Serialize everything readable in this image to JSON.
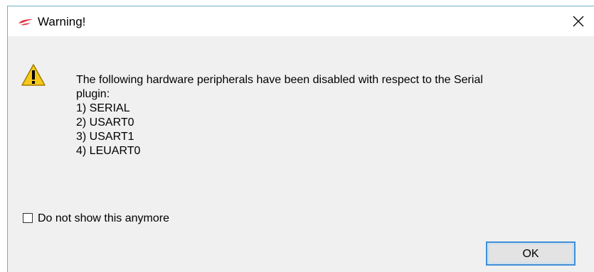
{
  "window": {
    "title": "Warning!",
    "app_icon": "silabs-logo-icon",
    "close_icon": "close-icon",
    "accent_color": "#3c8fd9"
  },
  "message": {
    "icon": "warning-icon",
    "line1": "The following hardware peripherals have been disabled with respect to the Serial",
    "line2": "plugin:",
    "items": [
      "1) SERIAL",
      "2) USART0",
      "3) USART1",
      "4) LEUART0"
    ]
  },
  "checkbox": {
    "label": "Do not show this anymore",
    "checked": false
  },
  "buttons": {
    "ok_label": "OK"
  }
}
